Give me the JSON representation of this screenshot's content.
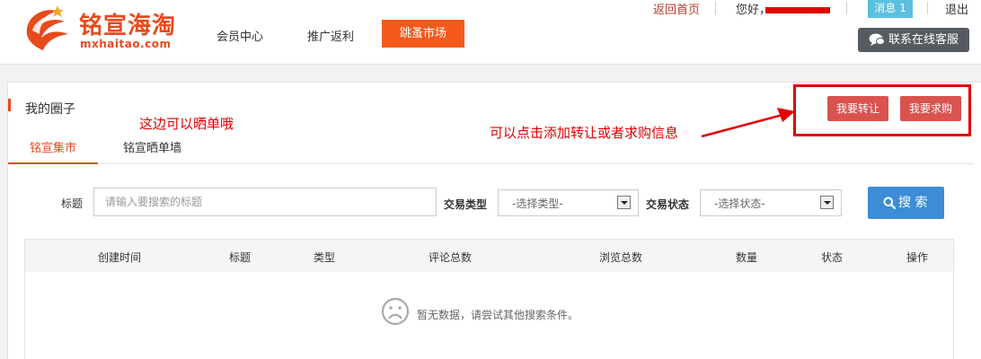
{
  "header": {
    "logo_cn": "铭宣海淘",
    "logo_en": "mxhaitao.com",
    "nav": [
      {
        "label": "会员中心"
      },
      {
        "label": "推广返利"
      },
      {
        "label": "跳蚤市场"
      }
    ],
    "top_links": {
      "home": "返回首页",
      "hello": "您好，",
      "message": "消息 1",
      "logout": "退出"
    },
    "support": "联系在线客服"
  },
  "panel": {
    "title": "我的圈子",
    "tabs": [
      {
        "label": "铭宣集市",
        "active": true
      },
      {
        "label": "铭宣晒单墙",
        "active": false
      }
    ],
    "buttons": {
      "transfer": "我要转让",
      "buy": "我要求购"
    }
  },
  "annotations": {
    "left": "这边可以晒单哦",
    "right": "可以点击添加转让或者求购信息"
  },
  "search": {
    "title_label": "标题",
    "title_placeholder": "请输入要搜索的标题",
    "type_label": "交易类型",
    "type_value": "-选择类型-",
    "status_label": "交易状态",
    "status_value": "-选择状态-",
    "search_button": "搜 索"
  },
  "table": {
    "columns": [
      "创建时间",
      "标题",
      "类型",
      "评论总数",
      "浏览总数",
      "数量",
      "状态",
      "操作"
    ],
    "empty_text": "暂无数据，请尝试其他搜索条件。"
  },
  "colors": {
    "brand": "#e84a1c",
    "flea_button": "#f55a1c",
    "action_button": "#d9534f",
    "search_button": "#3c8dd5",
    "annotation": "#e00000",
    "message_badge": "#5bc0de",
    "support_button": "#555b61"
  }
}
